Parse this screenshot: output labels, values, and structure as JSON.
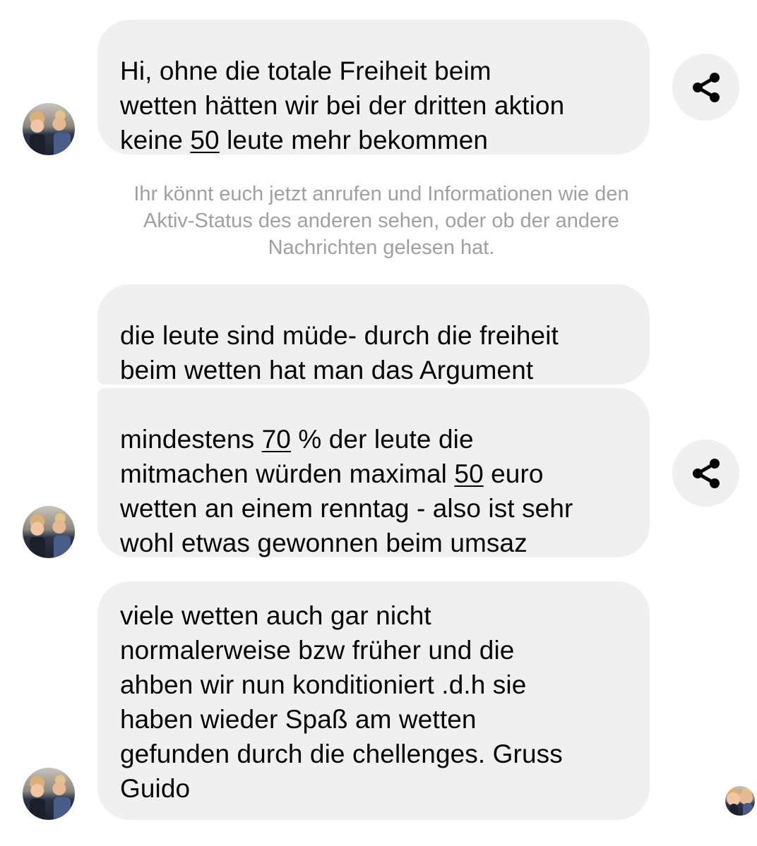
{
  "messages": [
    {
      "lines": [
        [
          {
            "t": "Hi, ohne die totale Freiheit beim"
          }
        ],
        [
          {
            "t": "wetten hätten wir bei der dritten aktion"
          }
        ],
        [
          {
            "t": "keine "
          },
          {
            "t": "50",
            "u": true
          },
          {
            "t": " leute mehr bekommen"
          }
        ]
      ]
    },
    {
      "lines": [
        [
          {
            "t": "die leute sind müde- durch die freiheit"
          }
        ],
        [
          {
            "t": "beim wetten hat man das Argument"
          }
        ]
      ]
    },
    {
      "lines": [
        [
          {
            "t": "mindestens "
          },
          {
            "t": "70",
            "u": true
          },
          {
            "t": " % der leute die"
          }
        ],
        [
          {
            "t": "mitmachen würden maximal "
          },
          {
            "t": "50",
            "u": true
          },
          {
            "t": " euro"
          }
        ],
        [
          {
            "t": "wetten an einem renntag - also ist sehr"
          }
        ],
        [
          {
            "t": "wohl etwas gewonnen beim umsaz"
          }
        ]
      ]
    },
    {
      "lines": [
        [
          {
            "t": "viele wetten auch gar nicht"
          }
        ],
        [
          {
            "t": "normalerweise bzw früher und die"
          }
        ],
        [
          {
            "t": "ahben wir nun konditioniert .d.h sie"
          }
        ],
        [
          {
            "t": "haben wieder Spaß am wetten"
          }
        ],
        [
          {
            "t": "gefunden durch die chellenges. Gruss"
          }
        ],
        [
          {
            "t": "Guido"
          }
        ]
      ]
    }
  ],
  "system_notice": {
    "lines": [
      "Ihr könnt euch jetzt anrufen und Informationen wie den",
      "Aktiv-Status des anderen sehen, oder ob der andere",
      "Nachrichten gelesen hat."
    ]
  },
  "icons": {
    "share": "share-icon",
    "avatar": "contact-avatar"
  },
  "colors": {
    "bubble": "#f0f0f0",
    "text": "#050505",
    "system_text": "#a0a0a0",
    "share_bg": "#f0f0f0"
  }
}
